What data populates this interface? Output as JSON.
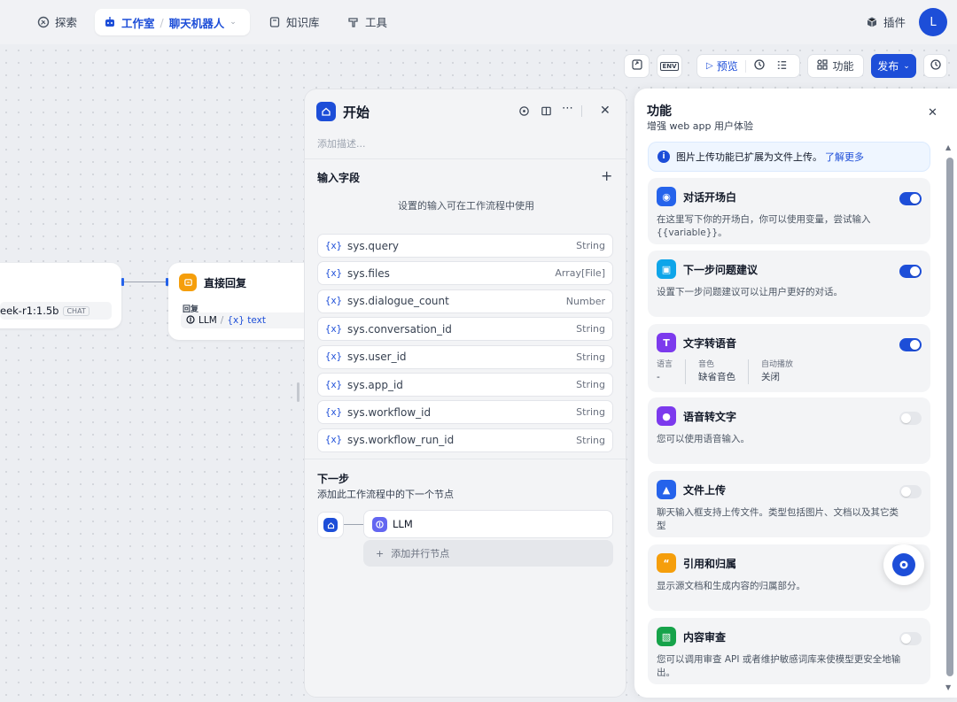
{
  "nav": {
    "explore": "探索",
    "studio": "工作室",
    "app_name": "聊天机器人",
    "knowledge": "知识库",
    "tools": "工具",
    "plugins": "插件",
    "avatar_letter": "L"
  },
  "toolbar": {
    "env": "ENV",
    "preview": "预览",
    "features": "功能",
    "publish": "发布"
  },
  "canvas": {
    "llm_node_model": "eek-r1:1.5b",
    "llm_node_badge": "CHAT",
    "answer_node_title": "直接回复",
    "answer_node_sub": "回复",
    "answer_node_ref_src": "LLM",
    "answer_node_ref_sep": "/",
    "answer_node_ref_var": "{x} text"
  },
  "start_panel": {
    "title": "开始",
    "desc_placeholder": "添加描述...",
    "input_section": "输入字段",
    "input_hint": "设置的输入可在工作流程中使用",
    "var_marker": "{x}",
    "fields": [
      {
        "name": "sys.query",
        "type": "String"
      },
      {
        "name": "sys.files",
        "type": "Array[File]"
      },
      {
        "name": "sys.dialogue_count",
        "type": "Number"
      },
      {
        "name": "sys.conversation_id",
        "type": "String"
      },
      {
        "name": "sys.user_id",
        "type": "String"
      },
      {
        "name": "sys.app_id",
        "type": "String"
      },
      {
        "name": "sys.workflow_id",
        "type": "String"
      },
      {
        "name": "sys.workflow_run_id",
        "type": "String"
      }
    ],
    "next_title": "下一步",
    "next_desc": "添加此工作流程中的下一个节点",
    "next_node": "LLM",
    "add_parallel": "添加并行节点"
  },
  "features_panel": {
    "title": "功能",
    "subtitle": "增强 web app 用户体验",
    "notice": "图片上传功能已扩展为文件上传。",
    "notice_link": "了解更多",
    "cards": [
      {
        "title": "对话开场白",
        "desc": "在这里写下你的开场白，你可以使用变量，尝试输入{{variable}}。",
        "on": true,
        "color": "#2563eb",
        "icon": "chat-bubble-icon"
      },
      {
        "title": "下一步问题建议",
        "desc": "设置下一步问题建议可以让用户更好的对话。",
        "on": true,
        "color": "#0ea5e9",
        "icon": "suggest-icon"
      },
      {
        "title": "文字转语音",
        "on": true,
        "color": "#7c3aed",
        "icon": "text-to-speech-icon"
      },
      {
        "title": "语音转文字",
        "desc": "您可以使用语音输入。",
        "on": false,
        "color": "#7c3aed",
        "icon": "microphone-icon"
      },
      {
        "title": "文件上传",
        "desc": "聊天输入框支持上传文件。类型包括图片、文档以及其它类型",
        "on": false,
        "color": "#2563eb",
        "icon": "folder-upload-icon"
      },
      {
        "title": "引用和归属",
        "desc": "显示源文档和生成内容的归属部分。",
        "on": false,
        "color": "#f59e0b",
        "icon": "quote-icon"
      },
      {
        "title": "内容审查",
        "desc": "您可以调用审查 API 或者维护敏感词库来使模型更安全地输出。",
        "on": false,
        "color": "#16a34a",
        "icon": "moderation-icon"
      }
    ],
    "tts": {
      "lang_label": "语言",
      "lang_value": "-",
      "voice_label": "音色",
      "voice_value": "缺省音色",
      "autoplay_label": "自动播放",
      "autoplay_value": "关闭"
    }
  }
}
